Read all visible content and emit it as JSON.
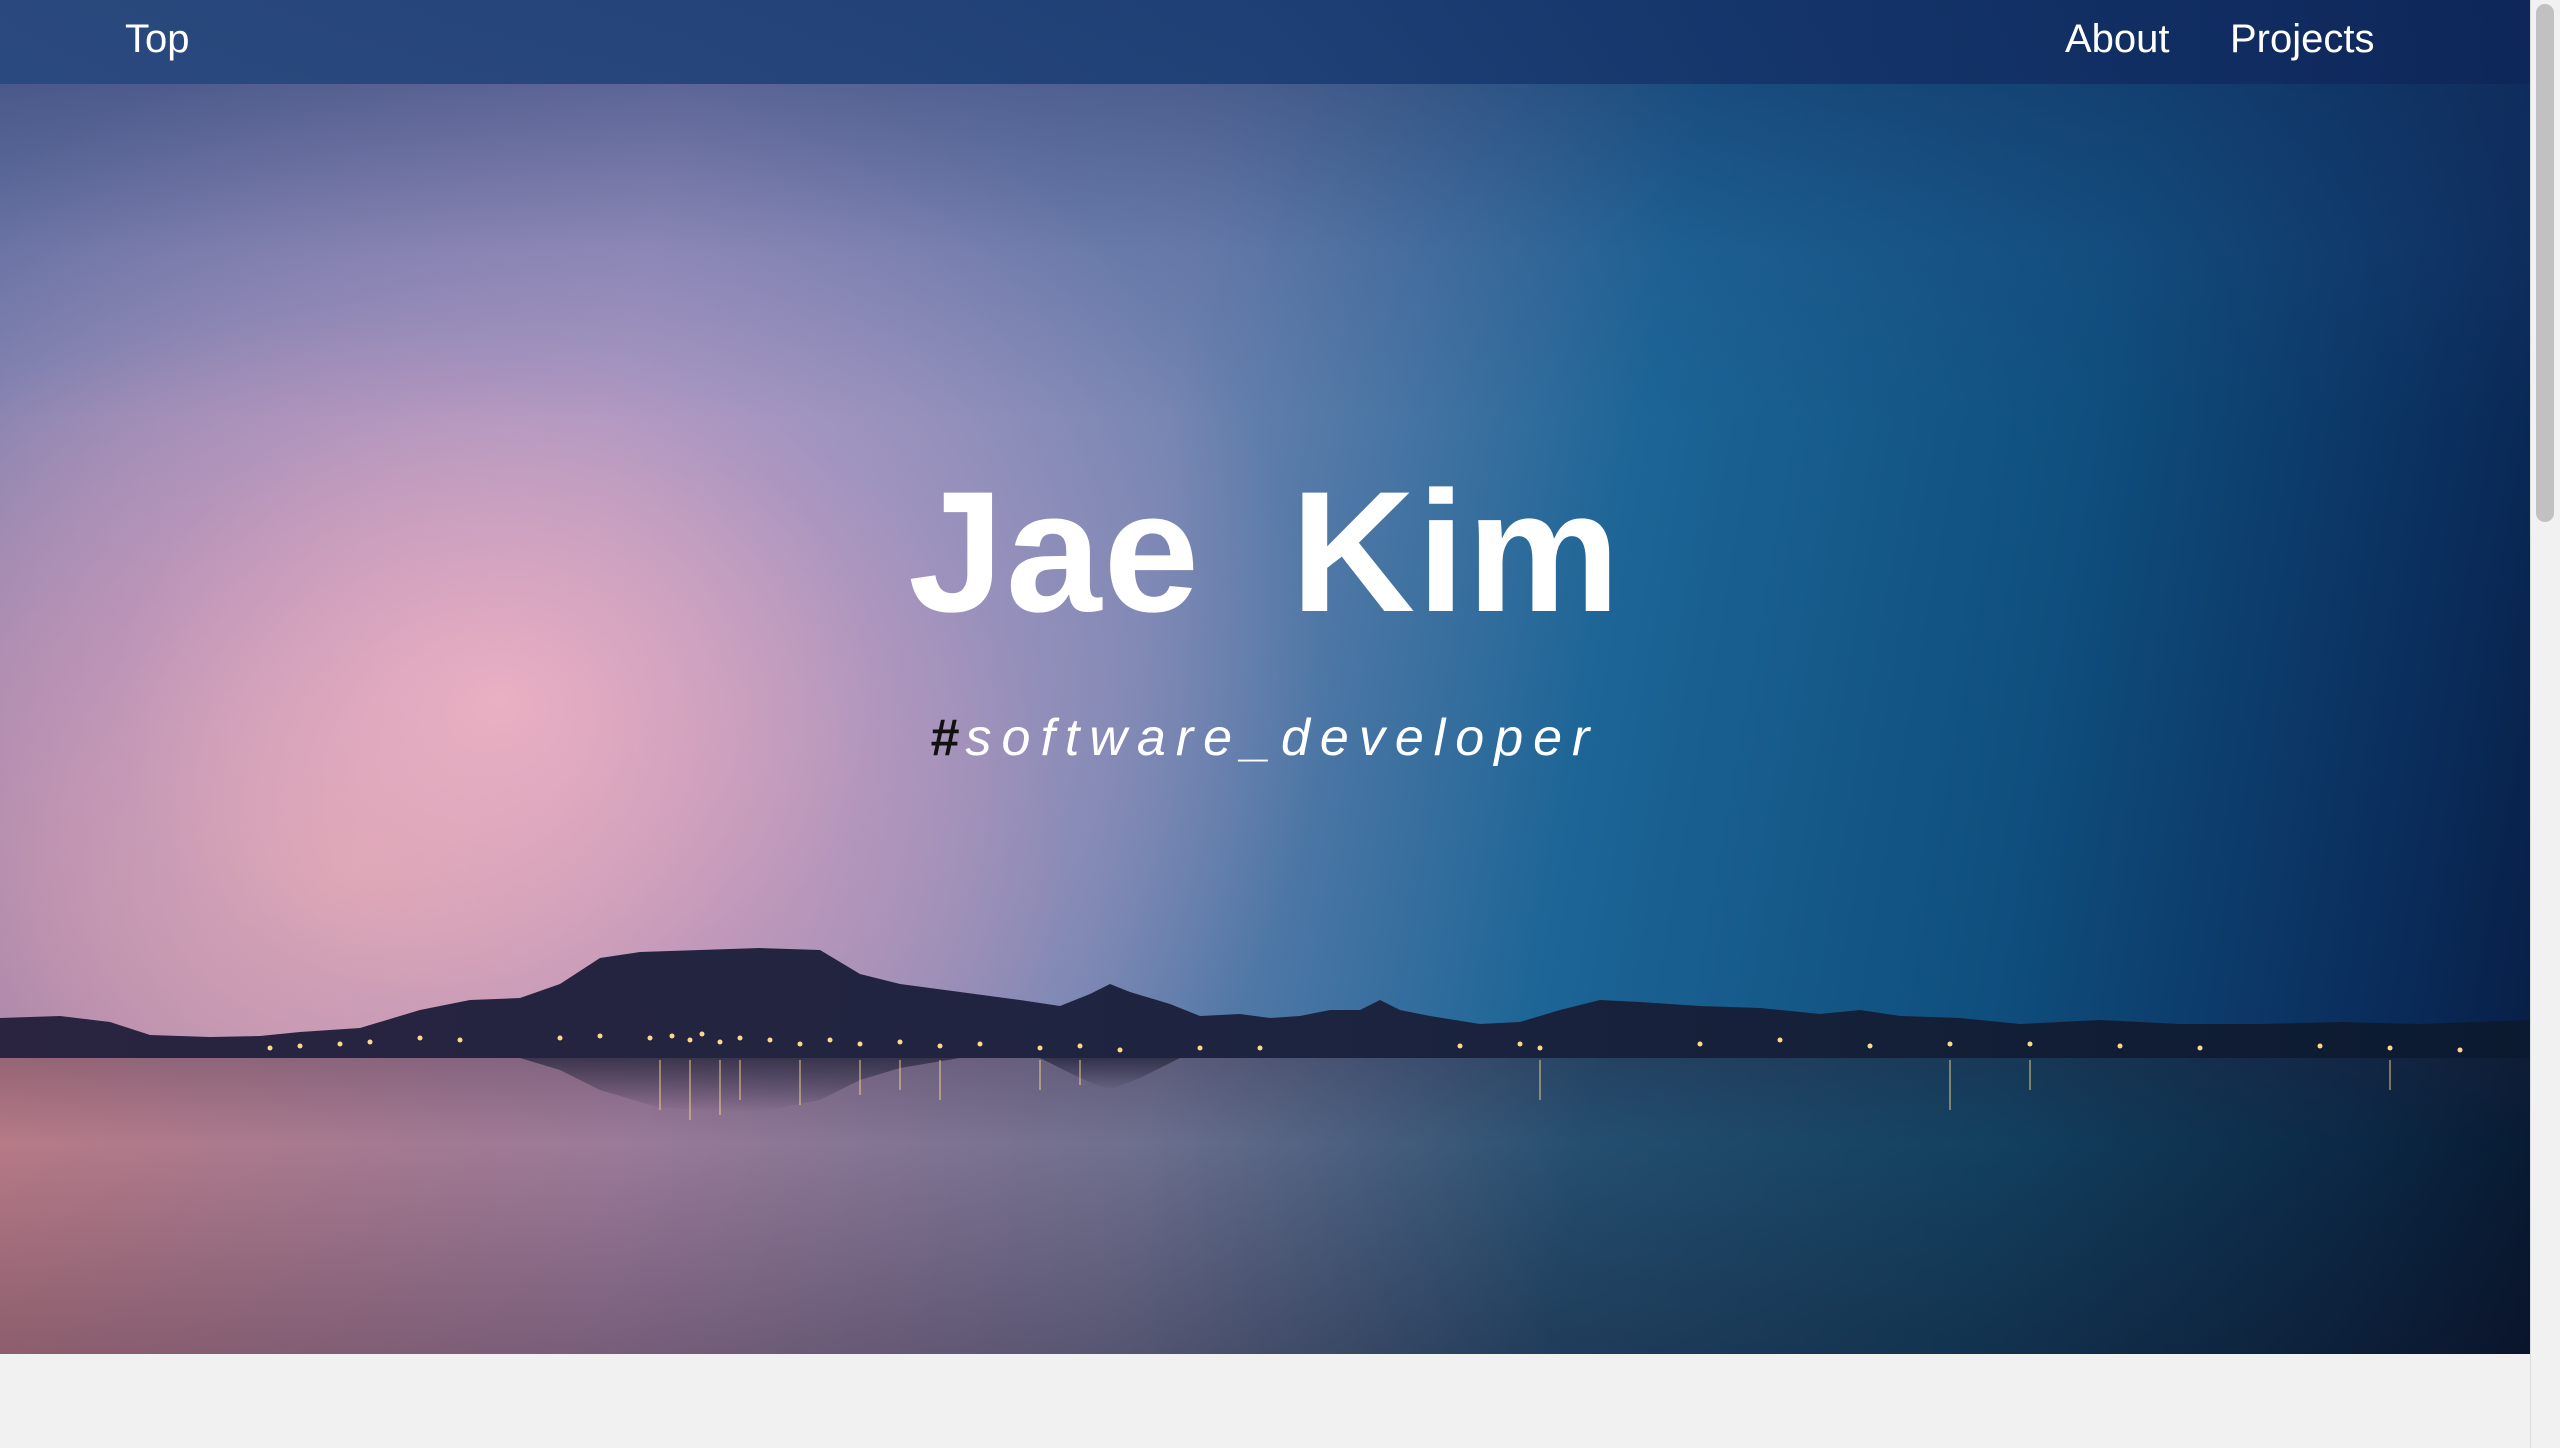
{
  "nav": {
    "left_label": "Top",
    "right_items": [
      {
        "label": "About"
      },
      {
        "label": "Projects"
      }
    ]
  },
  "hero": {
    "title": "Jae Kim",
    "subtitle_hash": "#",
    "subtitle_text": "software_developer"
  },
  "colors": {
    "nav_bg": "#1c3c73",
    "text": "#ffffff",
    "hash": "#111111",
    "page_bg": "#f1f1f1"
  }
}
